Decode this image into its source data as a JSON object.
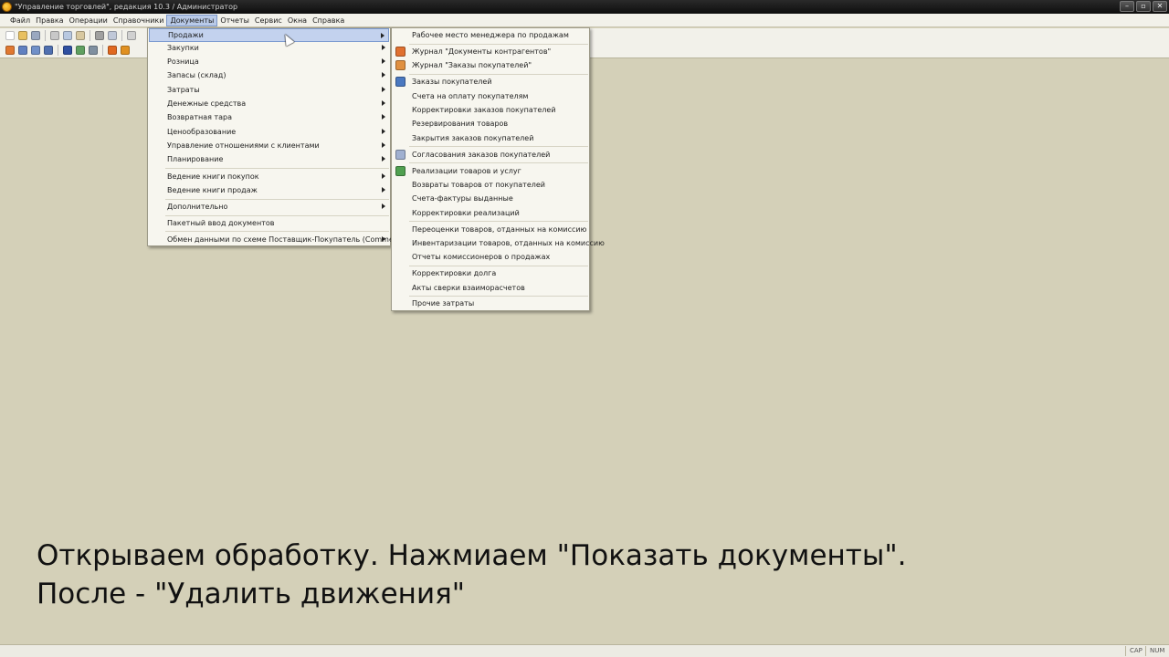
{
  "window": {
    "title": "\"Управление торговлей\", редакция 10.3 / Администратор",
    "controls": [
      "–",
      "▫",
      "✕"
    ]
  },
  "menubar": [
    {
      "label": "Файл"
    },
    {
      "label": "Правка"
    },
    {
      "label": "Операции"
    },
    {
      "label": "Справочники"
    },
    {
      "label": "Документы"
    },
    {
      "label": "Отчеты"
    },
    {
      "label": "Сервис"
    },
    {
      "label": "Окна"
    },
    {
      "label": "Справка"
    }
  ],
  "documents_menu": {
    "items": [
      {
        "label": "Продажи"
      },
      {
        "label": "Закупки"
      },
      {
        "label": "Розница"
      },
      {
        "label": "Запасы (склад)"
      },
      {
        "label": "Затраты"
      },
      {
        "label": "Денежные средства"
      },
      {
        "label": "Возвратная тара"
      },
      {
        "label": "Ценообразование"
      },
      {
        "label": "Управление отношениями с клиентами"
      },
      {
        "label": "Планирование"
      },
      {
        "label": "Ведение книги покупок"
      },
      {
        "label": "Ведение книги продаж"
      },
      {
        "label": "Дополнительно"
      },
      {
        "label": "Пакетный ввод документов"
      },
      {
        "label": "Обмен данными по схеме Поставщик-Покупатель (CommerceML)"
      }
    ]
  },
  "sales_submenu": {
    "items": [
      {
        "label": "Рабочее место менеджера по продажам"
      },
      {
        "label": "Журнал \"Документы контрагентов\""
      },
      {
        "label": "Журнал \"Заказы покупателей\""
      },
      {
        "label": "Заказы покупателей"
      },
      {
        "label": "Счета на оплату покупателям"
      },
      {
        "label": "Корректировки заказов покупателей"
      },
      {
        "label": "Резервирования товаров"
      },
      {
        "label": "Закрытия заказов покупателей"
      },
      {
        "label": "Согласования заказов покупателей"
      },
      {
        "label": "Реализации товаров и услуг"
      },
      {
        "label": "Возвраты товаров от покупателей"
      },
      {
        "label": "Счета-фактуры выданные"
      },
      {
        "label": "Корректировки реализаций"
      },
      {
        "label": "Переоценки товаров, отданных на комиссию"
      },
      {
        "label": "Инвентаризации товаров, отданных на комиссию"
      },
      {
        "label": "Отчеты комиссионеров о продажах"
      },
      {
        "label": "Корректировки долга"
      },
      {
        "label": "Акты сверки взаиморасчетов"
      },
      {
        "label": "Прочие затраты"
      }
    ]
  },
  "subtitle": {
    "line1": "Открываем обработку. Нажмиаем \"Показать документы\".",
    "line2": "После - \"Удалить движения\""
  },
  "statusbar": {
    "cap": "CAP",
    "num": "NUM"
  }
}
